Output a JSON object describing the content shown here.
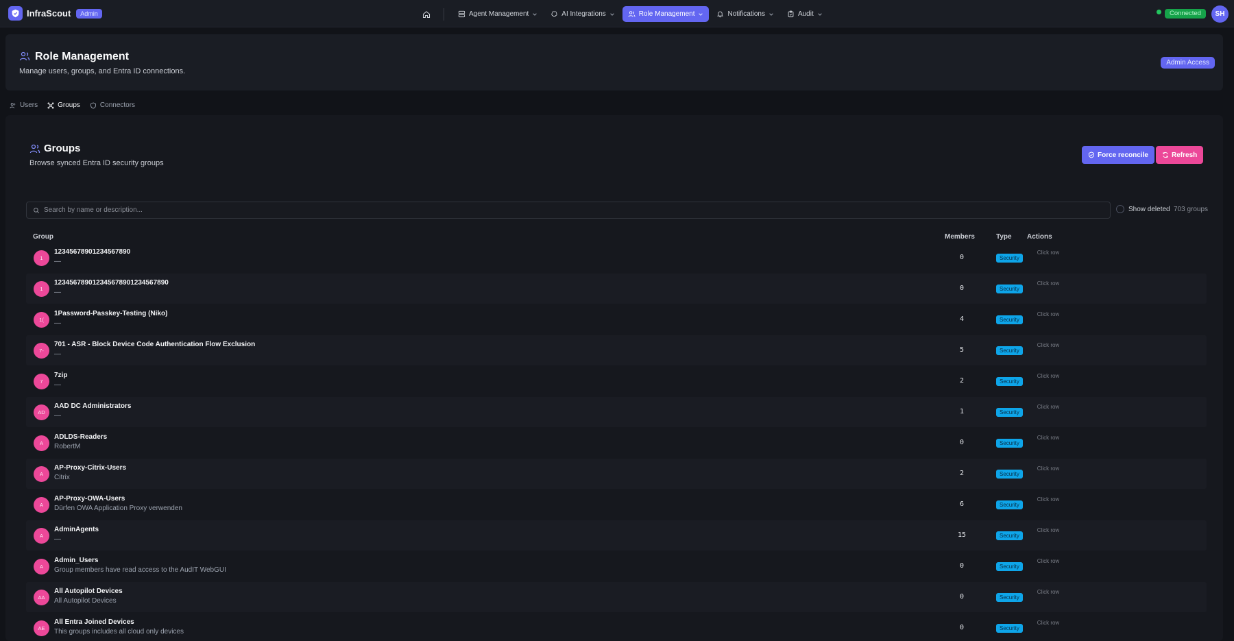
{
  "brand": {
    "name": "InfraScout",
    "badge": "Admin"
  },
  "nav": {
    "items": [
      {
        "label": "Agent Management",
        "icon": "server-icon",
        "active": false
      },
      {
        "label": "AI Integrations",
        "icon": "brain-icon",
        "active": false
      },
      {
        "label": "Role Management",
        "icon": "users-icon",
        "active": true
      },
      {
        "label": "Notifications",
        "icon": "bell-icon",
        "active": false
      },
      {
        "label": "Audit",
        "icon": "clipboard-icon",
        "active": false
      }
    ]
  },
  "status": {
    "connection": "Connected",
    "user_initials": "SH"
  },
  "page": {
    "title": "Role Management",
    "subtitle": "Manage users, groups, and Entra ID connections.",
    "access_badge": "Admin Access"
  },
  "tabs": [
    {
      "label": "Users",
      "active": false
    },
    {
      "label": "Groups",
      "active": true
    },
    {
      "label": "Connectors",
      "active": false
    }
  ],
  "groups": {
    "title": "Groups",
    "subtitle": "Browse synced Entra ID security groups",
    "force_reconcile": "Force reconcile",
    "refresh": "Refresh",
    "search_placeholder": "Search by name or description...",
    "show_deleted": "Show deleted",
    "count": "703 groups",
    "columns": {
      "group": "Group",
      "members": "Members",
      "type": "Type",
      "actions": "Actions"
    },
    "rows": [
      {
        "initials": "1",
        "name": "12345678901234567890",
        "description": "—",
        "members": "0",
        "type": "Security",
        "action": "Click row"
      },
      {
        "initials": "1",
        "name": "123456789012345678901234567890",
        "description": "—",
        "members": "0",
        "type": "Security",
        "action": "Click row"
      },
      {
        "initials": "1(",
        "name": "1Password-Passkey-Testing (Niko)",
        "description": "—",
        "members": "4",
        "type": "Security",
        "action": "Click row"
      },
      {
        "initials": "7-",
        "name": "701 - ASR - Block Device Code Authentication Flow Exclusion",
        "description": "—",
        "members": "5",
        "type": "Security",
        "action": "Click row"
      },
      {
        "initials": "7",
        "name": "7zip",
        "description": "—",
        "members": "2",
        "type": "Security",
        "action": "Click row"
      },
      {
        "initials": "AD",
        "name": "AAD DC Administrators",
        "description": "—",
        "members": "1",
        "type": "Security",
        "action": "Click row"
      },
      {
        "initials": "A",
        "name": "ADLDS-Readers",
        "description": "RobertM",
        "members": "0",
        "type": "Security",
        "action": "Click row"
      },
      {
        "initials": "A",
        "name": "AP-Proxy-Citrix-Users",
        "description": "Citrix",
        "members": "2",
        "type": "Security",
        "action": "Click row"
      },
      {
        "initials": "A",
        "name": "AP-Proxy-OWA-Users",
        "description": "Dürfen OWA Application Proxy verwenden",
        "members": "6",
        "type": "Security",
        "action": "Click row"
      },
      {
        "initials": "A",
        "name": "AdminAgents",
        "description": "—",
        "members": "15",
        "type": "Security",
        "action": "Click row"
      },
      {
        "initials": "A",
        "name": "Admin_Users",
        "description": "Group members have read access to the AudIT WebGUI",
        "members": "0",
        "type": "Security",
        "action": "Click row"
      },
      {
        "initials": "AA",
        "name": "All Autopilot Devices",
        "description": "All Autopilot Devices",
        "members": "0",
        "type": "Security",
        "action": "Click row"
      },
      {
        "initials": "AE",
        "name": "All Entra Joined Devices",
        "description": "This groups includes all cloud only devices",
        "members": "0",
        "type": "Security",
        "action": "Click row"
      }
    ]
  },
  "colors": {
    "accent": "#6366f1",
    "pink": "#ec4899",
    "success": "#16a34a",
    "type_badge": "#0ea5e9"
  }
}
